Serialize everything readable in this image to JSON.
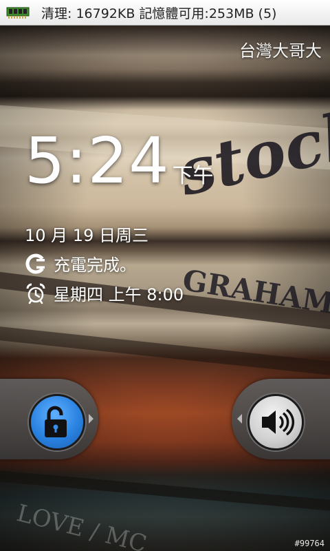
{
  "status_bar": {
    "text": "清理: 16792KB 記憶體可用:253MB (5)",
    "icon": "memory-chip-icon"
  },
  "carrier": "台灣大哥大",
  "clock": {
    "time": "5:24",
    "ampm": "下午"
  },
  "date": "10 月 19 日周三",
  "charging": {
    "icon": "charging-plug-icon",
    "text": "充電完成。"
  },
  "alarm": {
    "icon": "alarm-clock-icon",
    "text": "星期四 上午 8:00"
  },
  "slider": {
    "unlock_icon": "unlock-padlock-icon",
    "sound_icon": "speaker-volume-icon",
    "unlock_color": "#2a82e0"
  },
  "wallpaper": {
    "text_stock": "stock",
    "text_graham": "GRAHAM",
    "text_love": "LOVE / MC"
  },
  "watermark": "#99764"
}
